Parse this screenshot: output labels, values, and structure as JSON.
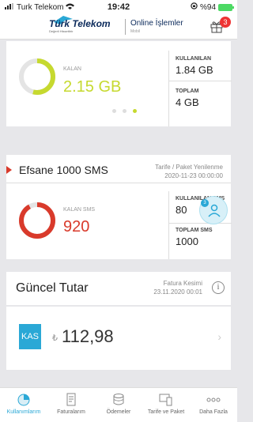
{
  "status": {
    "carrier": "Turk Telekom",
    "time": "19:42",
    "battery": "%94"
  },
  "header": {
    "logo_name": "Türk Telekom",
    "logo_sub": "Değerli Hissettirir",
    "title": "Online İşlemler",
    "subtitle": "Mobil",
    "gift_badge": "3"
  },
  "data_card": {
    "remaining_label": "KALAN",
    "remaining_value": "2.15 GB",
    "used_label": "KULLANILAN",
    "used_value": "1.84 GB",
    "total_label": "TOPLAM",
    "total_value": "4 GB",
    "remaining_fraction": 0.54,
    "accent": "#c6d92f"
  },
  "sms_card": {
    "title": "Efsane 1000 SMS",
    "renew_label": "Tarife / Paket Yenilenme",
    "renew_date": "2020-11-23 00:00:00",
    "remaining_label": "KALAN SMS",
    "remaining_value": "920",
    "used_label": "KULLANILAN SMS",
    "used_value": "80",
    "total_label": "TOPLAM SMS",
    "total_value": "1000",
    "remaining_fraction": 0.92,
    "accent": "#d93a2b",
    "assistant_badge": "3"
  },
  "bill_card": {
    "title": "Güncel Tutar",
    "cutoff_label": "Fatura Kesimi",
    "cutoff_date": "23.11.2020 00:01",
    "month": "KAS",
    "currency": "₺",
    "amount": "112,98"
  },
  "tabs": [
    {
      "label": "Kullanımlarım",
      "icon": "pie-chart-icon"
    },
    {
      "label": "Faturalarım",
      "icon": "invoice-icon"
    },
    {
      "label": "Ödemeler",
      "icon": "coins-icon"
    },
    {
      "label": "Tarife ve Paket",
      "icon": "devices-icon"
    },
    {
      "label": "Daha Fazla",
      "icon": "more-icon"
    }
  ]
}
